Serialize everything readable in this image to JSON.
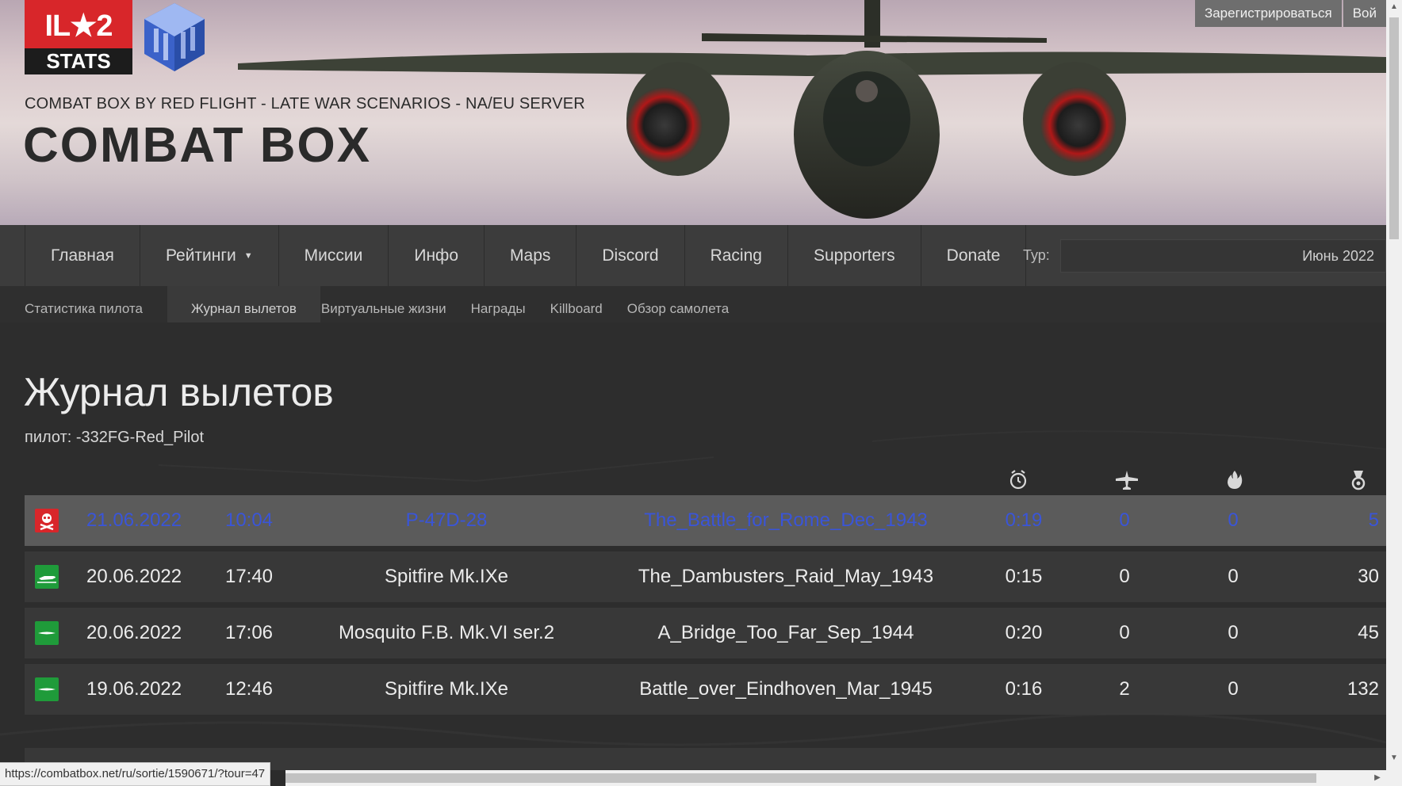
{
  "header": {
    "logo_top": "IL★2",
    "logo_bottom": "STATS",
    "server_subtitle": "COMBAT BOX BY RED FLIGHT - LATE WAR SCENARIOS - NA/EU SERVER",
    "server_title": "COMBAT BOX",
    "register_label": "Зарегистрироваться",
    "login_label": "Вой"
  },
  "main_nav": {
    "items": [
      "Главная",
      "Рейтинги",
      "Миссии",
      "Инфо",
      "Maps",
      "Discord",
      "Racing",
      "Supporters",
      "Donate"
    ],
    "tour_label": "Тур:",
    "tour_value": "Июнь 2022"
  },
  "sub_nav": {
    "items": [
      "Статистика пилота",
      "Журнал вылетов",
      "Виртуальные жизни",
      "Награды",
      "Killboard",
      "Обзор самолета"
    ],
    "active_index": 1
  },
  "page": {
    "title": "Журнал вылетов",
    "pilot": "пилот: -332FG-Red_Pilot"
  },
  "columns": {
    "icons": [
      "clock-icon",
      "plane-icon",
      "fire-icon",
      "medal-icon"
    ]
  },
  "sorties": [
    {
      "status": "killed",
      "date": "21.06.2022",
      "time": "10:04",
      "aircraft": "P-47D-28",
      "mission": "The_Battle_for_Rome_Dec_1943",
      "duration": "0:19",
      "air_kills": "0",
      "ground_kills": "0",
      "score": "5"
    },
    {
      "status": "landed",
      "date": "20.06.2022",
      "time": "17:40",
      "aircraft": "Spitfire Mk.IXe",
      "mission": "The_Dambusters_Raid_May_1943",
      "duration": "0:15",
      "air_kills": "0",
      "ground_kills": "0",
      "score": "30"
    },
    {
      "status": "landed",
      "date": "20.06.2022",
      "time": "17:06",
      "aircraft": "Mosquito F.B. Mk.VI ser.2",
      "mission": "A_Bridge_Too_Far_Sep_1944",
      "duration": "0:20",
      "air_kills": "0",
      "ground_kills": "0",
      "score": "45"
    },
    {
      "status": "landed",
      "date": "19.06.2022",
      "time": "12:46",
      "aircraft": "Spitfire Mk.IXe",
      "mission": "Battle_over_Eindhoven_Mar_1945",
      "duration": "0:16",
      "air_kills": "2",
      "ground_kills": "0",
      "score": "132"
    }
  ],
  "status_bar": {
    "url": "https://combatbox.net/ru/sortie/1590671/?tour=47"
  },
  "colors": {
    "accent_red": "#d8262a",
    "status_ok": "#1f9b3a",
    "link_blue": "#3a55d8"
  }
}
